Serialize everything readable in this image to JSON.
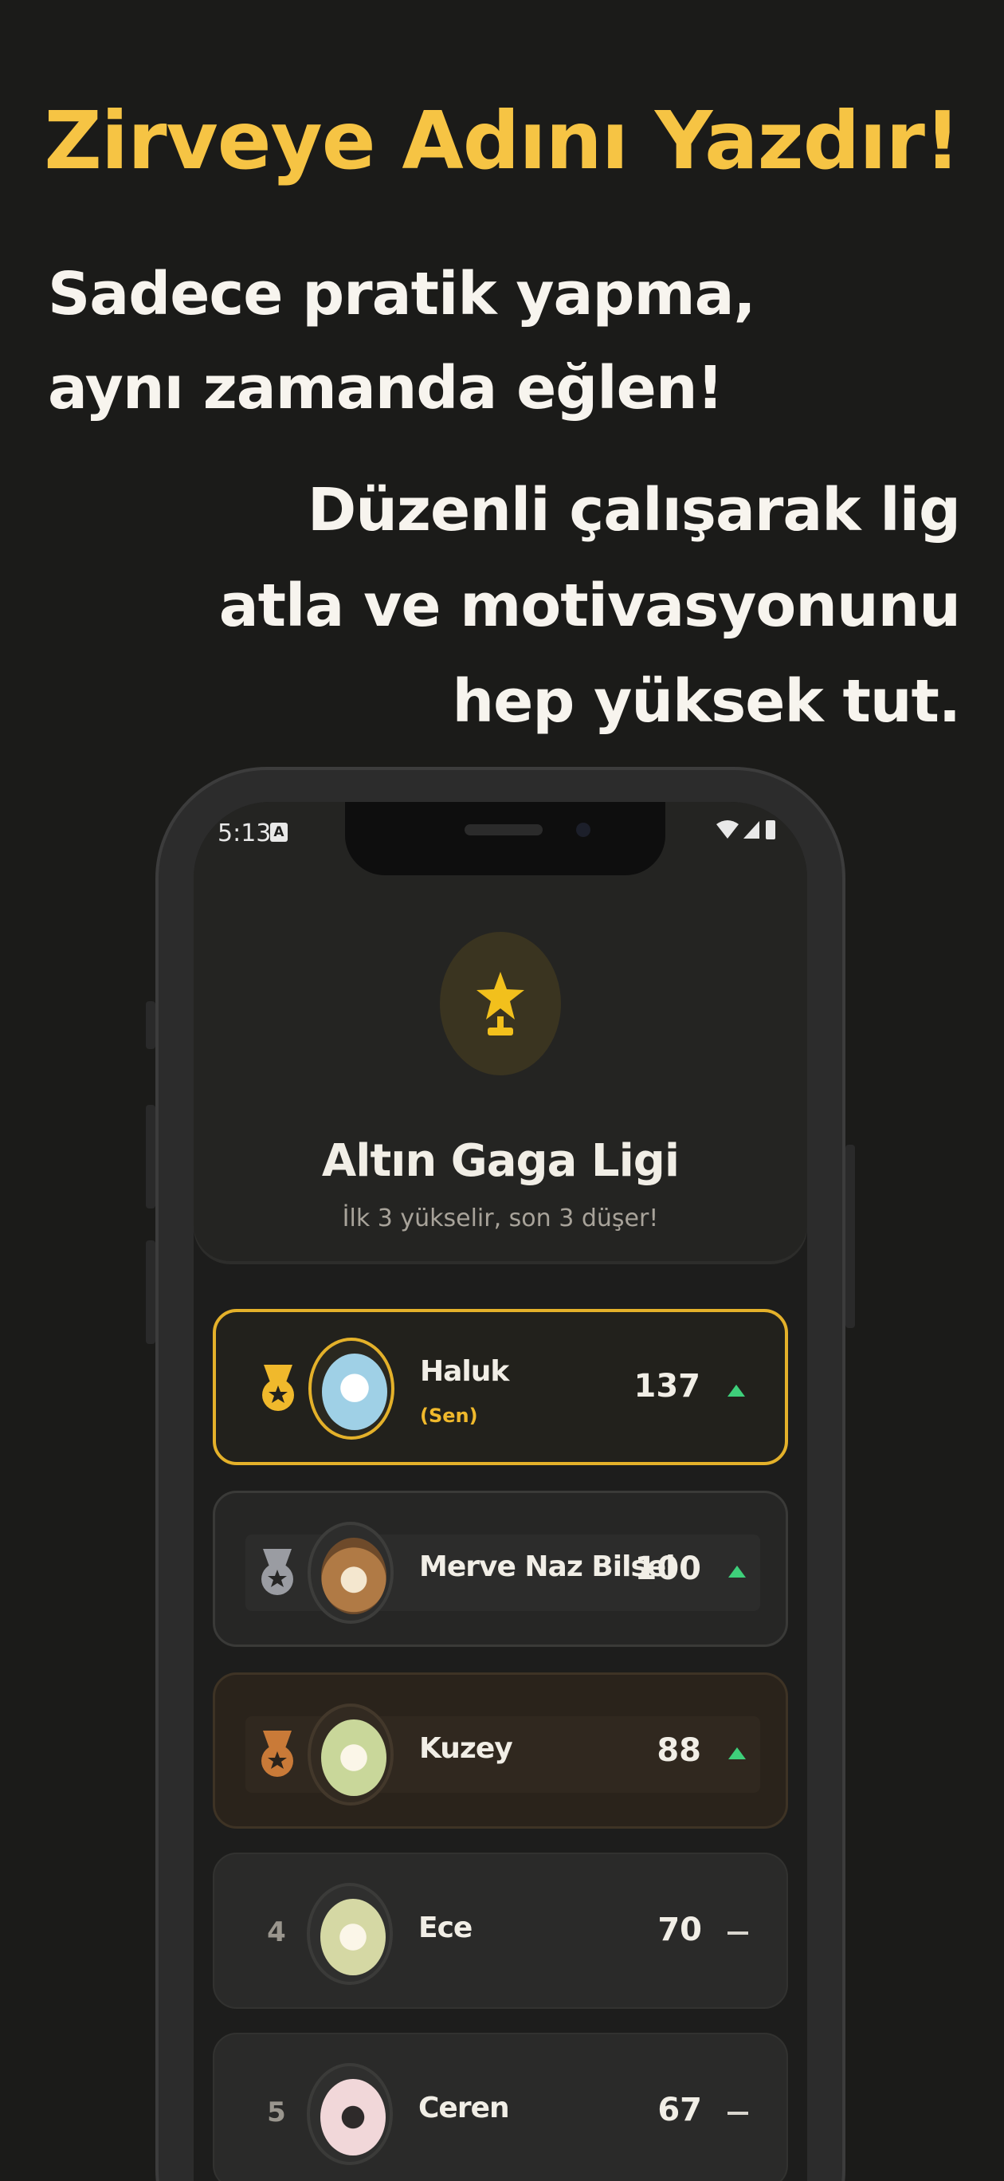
{
  "headline": "Zirveye Adını Yazdır!",
  "lead": [
    "Sadece pratik yapma,",
    "aynı zamanda eğlen!"
  ],
  "sub": [
    "Düzenli çalışarak lig",
    "atla ve motivasyonunu",
    "hep yüksek tut."
  ],
  "phone": {
    "status": {
      "time": "5:13",
      "badge": "A"
    },
    "league": {
      "title": "Altın Gaga Ligi",
      "subtitle": "İlk 3 yükselir, son 3 düşer!"
    },
    "leaderboard": [
      {
        "rank": "1",
        "name": "Haluk",
        "tag": "(Sen)",
        "score": "137",
        "trend": "up",
        "medal": "gold"
      },
      {
        "rank": "2",
        "name": "Merve Naz Bilsel",
        "tag": "",
        "score": "100",
        "trend": "up",
        "medal": "silver"
      },
      {
        "rank": "3",
        "name": "Kuzey",
        "tag": "",
        "score": "88",
        "trend": "up",
        "medal": "bronze"
      },
      {
        "rank": "4",
        "name": "Ece",
        "tag": "",
        "score": "70",
        "trend": "same",
        "medal": "none"
      },
      {
        "rank": "5",
        "name": "Ceren",
        "tag": "",
        "score": "67",
        "trend": "same",
        "medal": "none"
      }
    ]
  },
  "colors": {
    "accent": "#f6c444",
    "background": "#1b1b19",
    "up": "#3ecf7a",
    "gold": "#f0b92c",
    "silver": "#9a9ca2",
    "bronze": "#c97a38"
  }
}
